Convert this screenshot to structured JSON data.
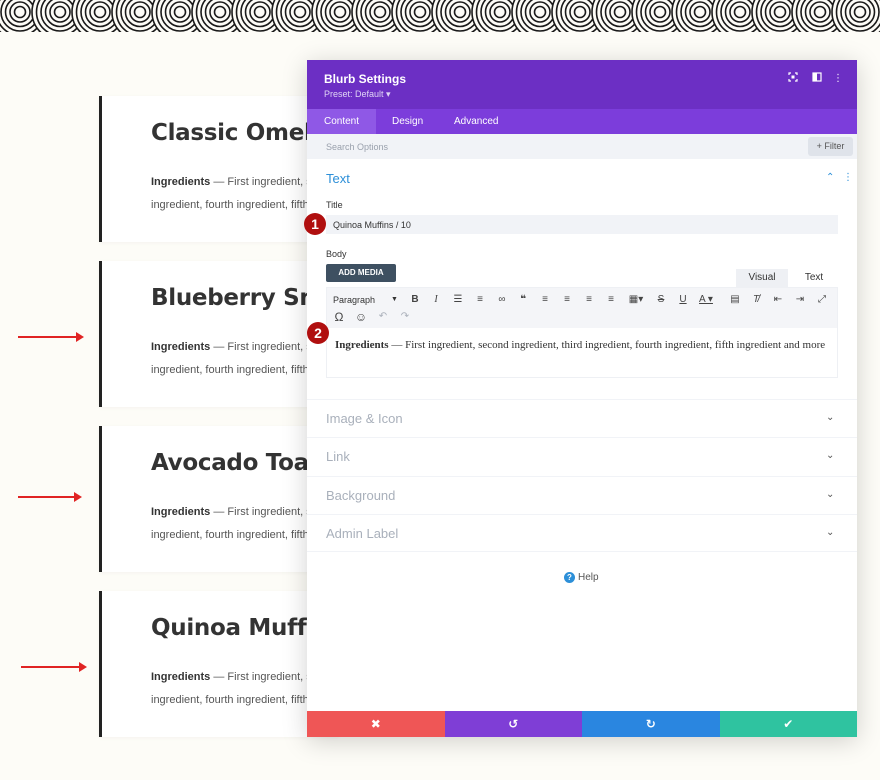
{
  "cards": [
    {
      "title": "Classic Omelette",
      "body_strong": "Ingredients",
      "body_text": " — First ingredient, second ingredient, third ingredient, fourth ingredient, fifth ingredient and more"
    },
    {
      "title": "Blueberry Smoothie",
      "body_strong": "Ingredients",
      "body_text": " — First ingredient, second ingredient, third ingredient, fourth ingredient, fifth ingredient and more"
    },
    {
      "title": "Avocado Toast",
      "body_strong": "Ingredients",
      "body_text": " — First ingredient, second ingredient, third ingredient, fourth ingredient, fifth ingredient and more"
    },
    {
      "title": "Quinoa Muffins",
      "body_strong": "Ingredients",
      "body_text": " — First ingredient, second ingredient, third ingredient, fourth ingredient, fifth ingredient and more"
    }
  ],
  "modal": {
    "title": "Blurb Settings",
    "preset": "Preset: Default ▾",
    "tabs": [
      "Content",
      "Design",
      "Advanced"
    ],
    "search_placeholder": "Search Options",
    "filter_label": "+ Filter",
    "section_title": "Text",
    "title_label": "Title",
    "title_value": "Quinoa Muffins / 10",
    "body_label": "Body",
    "add_media": "ADD MEDIA",
    "editor_tabs": {
      "visual": "Visual",
      "text": "Text"
    },
    "paragraph_select": "Paragraph",
    "editor_strong": "Ingredients",
    "editor_text": " — First ingredient, second ingredient, third ingredient, fourth ingredient, fifth ingredient and more",
    "collapsed_sections": [
      "Image & Icon",
      "Link",
      "Background",
      "Admin Label"
    ],
    "help": "Help"
  },
  "badges": [
    "1",
    "2"
  ],
  "colors": {
    "header": "#6c2fc4",
    "tabs": "#7c3ddb",
    "accent_blue": "#2c8fd8",
    "cancel": "#ef5656",
    "undo": "#7f3ed6",
    "redo": "#2a86e0",
    "save": "#2fc3a0",
    "badge": "#b00f0f",
    "arrow": "#e02424"
  },
  "icons": {
    "header": [
      "focus-icon",
      "split-view-icon",
      "more-vertical-icon"
    ],
    "footer": [
      "close-icon",
      "undo-icon",
      "redo-icon",
      "check-icon"
    ]
  }
}
